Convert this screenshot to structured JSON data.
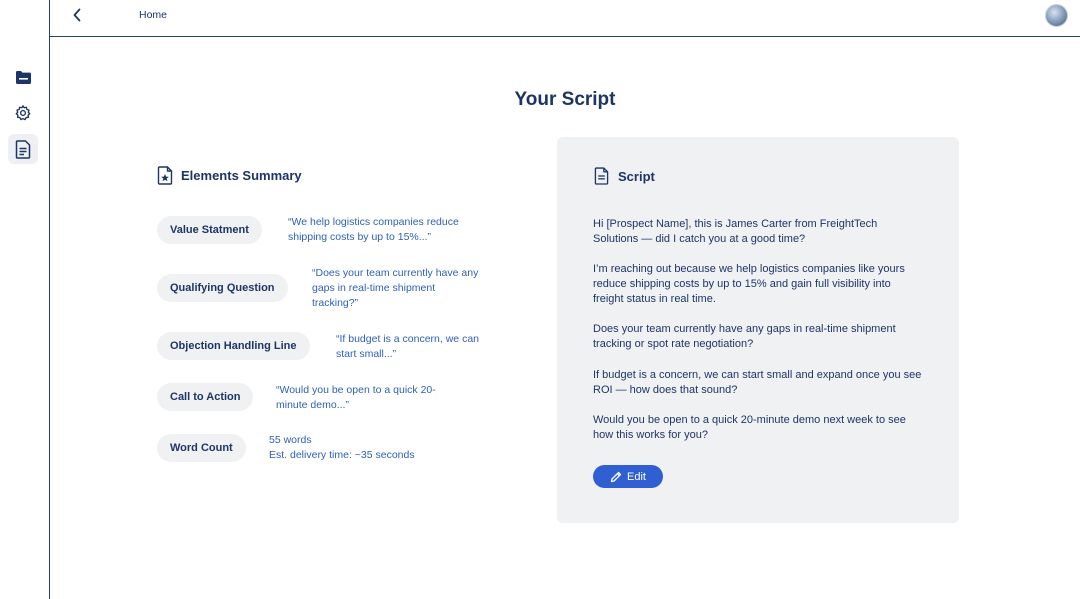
{
  "nav": {
    "breadcrumb": "Home",
    "icons": [
      "back-chevron-icon",
      "folder-icon",
      "settings-gear-icon",
      "document-icon"
    ]
  },
  "page": {
    "title": "Your Script"
  },
  "summary": {
    "heading": "Elements Summary",
    "items": [
      {
        "label": "Value Statment",
        "text": "“We help logistics companies reduce shipping costs by up to 15%...”"
      },
      {
        "label": "Qualifying Question",
        "text": "“Does your team currently have any gaps in real-time shipment tracking?”"
      },
      {
        "label": "Objection Handling Line",
        "text": "“If budget is a concern, we can start small...”"
      },
      {
        "label": "Call to Action",
        "text": "“Would you be open to a quick 20-minute demo...”"
      },
      {
        "label": "Word Count",
        "words": "55 words",
        "delivery": "Est. delivery time: ~35 seconds"
      }
    ]
  },
  "script": {
    "heading": "Script",
    "paragraphs": [
      "Hi [Prospect Name], this is James Carter from FreightTech Solutions — did I catch you at a good time?",
      "I’m reaching out because we help logistics companies like yours reduce shipping costs by up to 15% and gain full visibility into freight status in real time.",
      "Does your team currently have any gaps in real-time shipment tracking or spot rate negotiation?",
      "If budget is a concern, we can start small and expand once you see ROI — how does that sound?",
      "Would you be open to a quick 20-minute demo next week to see how this works for you?"
    ],
    "edit_label": "Edit"
  },
  "colors": {
    "primary": "#1d3566",
    "accent": "#2f5fd0",
    "link": "#2f5fb8",
    "card": "#f0f1f3"
  }
}
